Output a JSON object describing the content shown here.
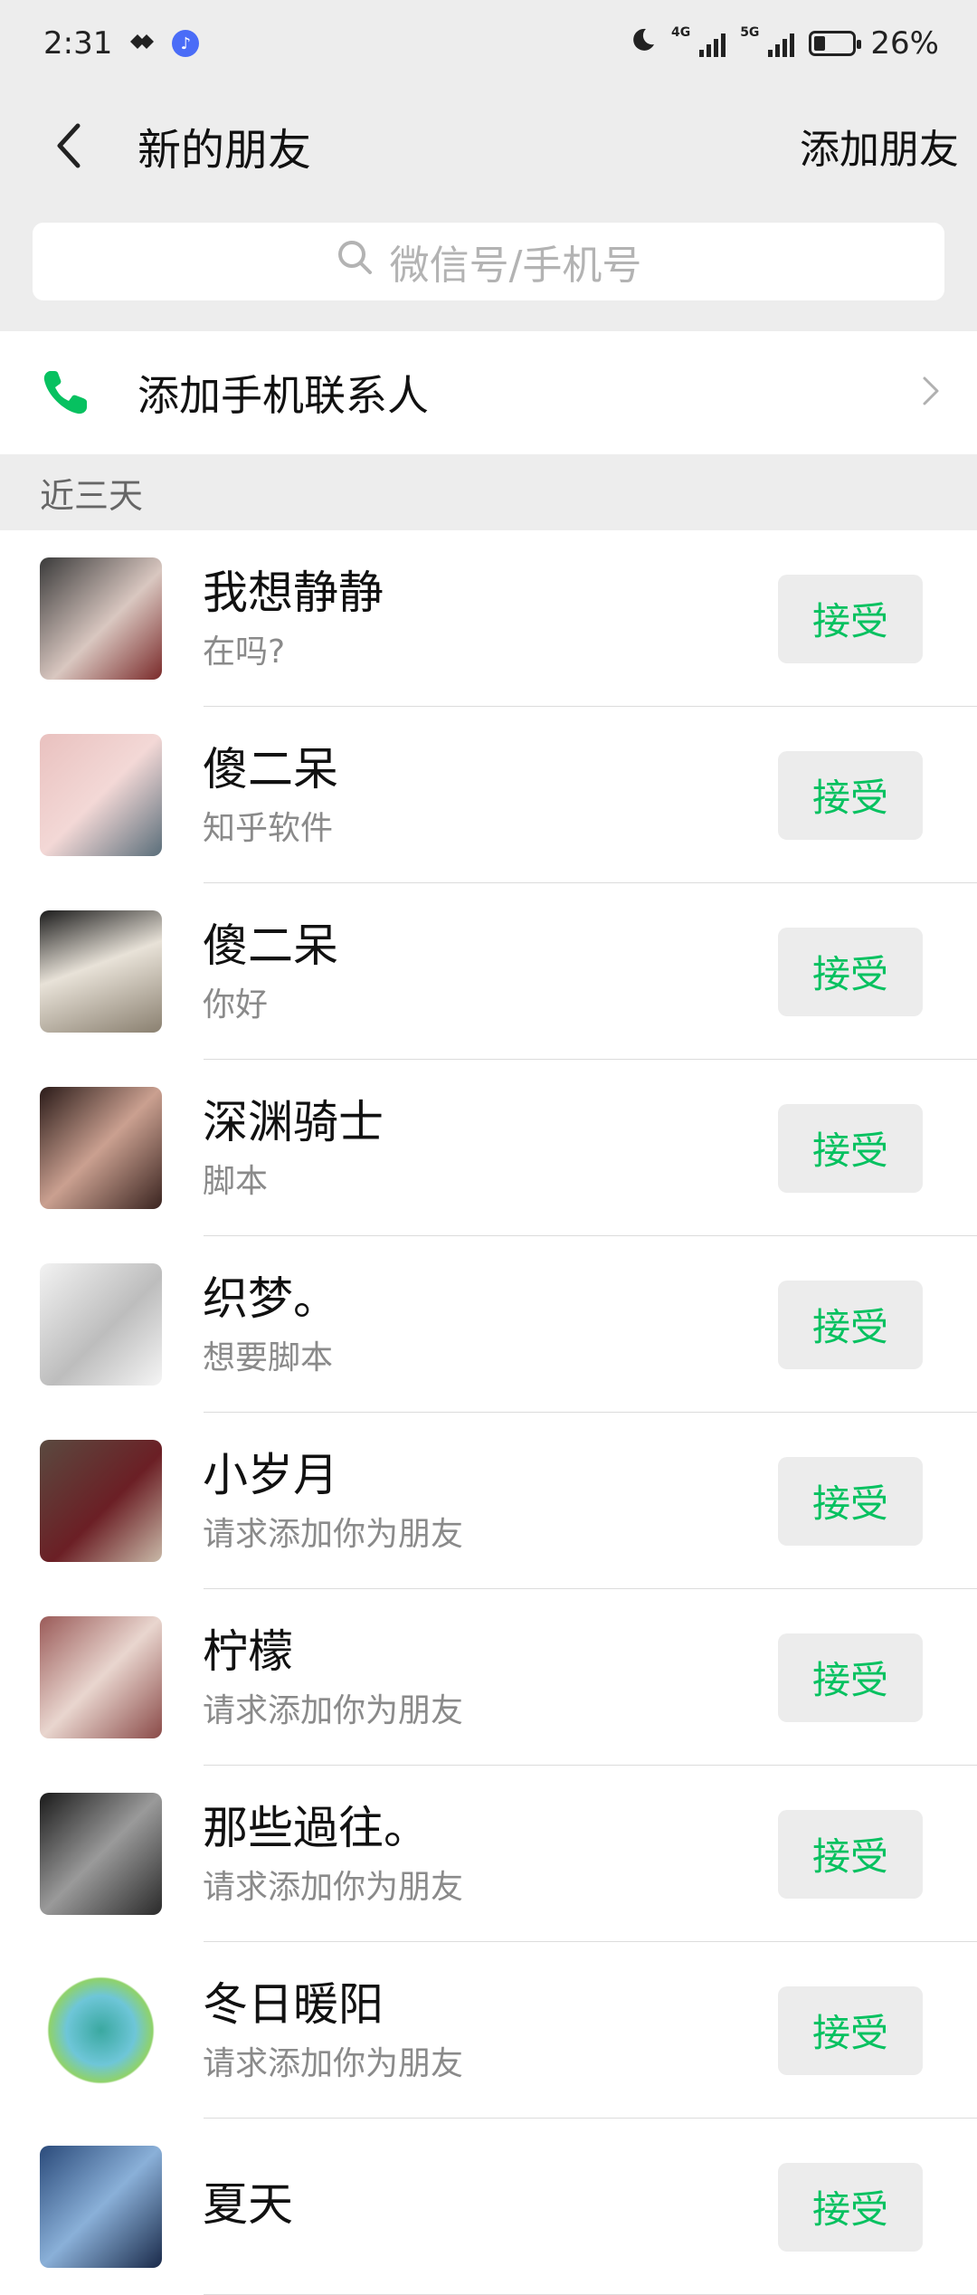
{
  "status_bar": {
    "time": "2:31",
    "battery": "26%",
    "net1": "4G",
    "net2": "5G"
  },
  "nav": {
    "title": "新的朋友",
    "action": "添加朋友"
  },
  "search": {
    "placeholder": "微信号/手机号"
  },
  "add_contact": {
    "label": "添加手机联系人"
  },
  "section_label": "近三天",
  "accept_label": "接受",
  "colors": {
    "accent": "#07c160",
    "background": "#ededed"
  },
  "requests": [
    {
      "name": "我想静静",
      "message": "在吗?"
    },
    {
      "name": "傻二呆",
      "message": "知乎软件"
    },
    {
      "name": "傻二呆",
      "message": "你好"
    },
    {
      "name": "深渊骑士",
      "message": "脚本"
    },
    {
      "name": "织梦。",
      "message": "想要脚本"
    },
    {
      "name": "小岁月",
      "message": "请求添加你为朋友"
    },
    {
      "name": "柠檬",
      "message": "请求添加你为朋友"
    },
    {
      "name": "那些過往。",
      "message": "请求添加你为朋友"
    },
    {
      "name": "冬日暖阳",
      "message": "请求添加你为朋友"
    },
    {
      "name": "夏天",
      "message": ""
    }
  ]
}
